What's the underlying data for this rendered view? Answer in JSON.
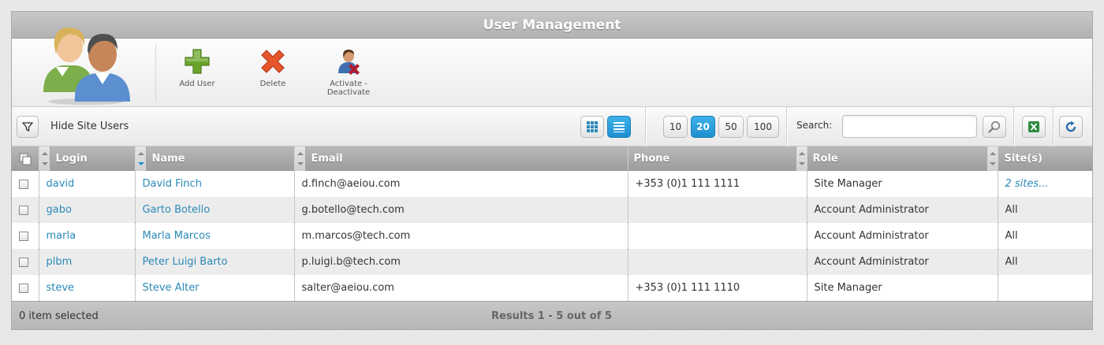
{
  "title": "User Management",
  "ribbon": {
    "add_label": "Add User",
    "delete_label": "Delete",
    "activate_label_line1": "Activate -",
    "activate_label_line2": "Deactivate"
  },
  "toolbar": {
    "hide_site_users_label": "Hide Site Users",
    "page_sizes": [
      "10",
      "20",
      "50",
      "100"
    ],
    "active_page_size": "20",
    "search_label": "Search:",
    "search_value": ""
  },
  "table": {
    "columns": [
      "Login",
      "Name",
      "Email",
      "Phone",
      "Role",
      "Site(s)"
    ],
    "rows": [
      {
        "login": "david",
        "name": "David Finch",
        "email": "d.finch@aeiou.com",
        "phone": "+353 (0)1 111 1111",
        "role": "Site Manager",
        "sites": "2 sites..."
      },
      {
        "login": "gabo",
        "name": "Garto Botello",
        "email": "g.botello@tech.com",
        "phone": "",
        "role": "Account Administrator",
        "sites": "All"
      },
      {
        "login": "marla",
        "name": "Marla Marcos",
        "email": "m.marcos@tech.com",
        "phone": "",
        "role": "Account Administrator",
        "sites": "All"
      },
      {
        "login": "plbm",
        "name": "Peter Luigi Barto",
        "email": "p.luigi.b@tech.com",
        "phone": "",
        "role": "Account Administrator",
        "sites": "All"
      },
      {
        "login": "steve",
        "name": "Steve Alter",
        "email": "salter@aeiou.com",
        "phone": "+353 (0)1 111 1110",
        "role": "Site Manager",
        "sites": ""
      }
    ]
  },
  "footer": {
    "selected_text": "0 item selected",
    "results_text": "Results 1 - 5 out of 5"
  },
  "icons": {
    "logo": "users-group-icon",
    "add": "plus-icon",
    "delete": "x-icon",
    "activate": "user-activate-icon",
    "filter": "filter-icon",
    "grid_view": "grid-view-icon",
    "list_view": "list-view-icon",
    "search": "magnifier-icon",
    "export": "excel-icon",
    "refresh": "refresh-icon"
  },
  "colors": {
    "link": "#2a8ab8",
    "active_button": "#1d8fd0",
    "add_green": "#6aa52a",
    "delete_orange": "#e5562b"
  }
}
